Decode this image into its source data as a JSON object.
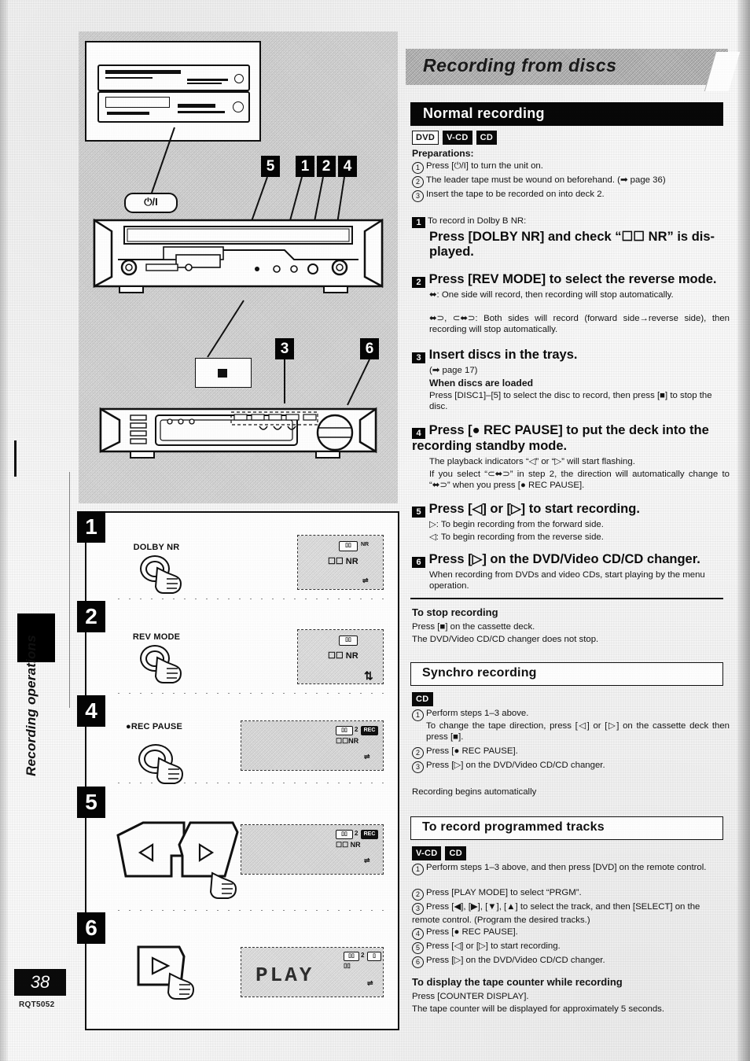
{
  "page": {
    "number": "38",
    "doc_code": "RQT5052",
    "side_tab": "Recording operations"
  },
  "section": {
    "title": "Recording from discs"
  },
  "normal_recording": {
    "heading": "Normal recording",
    "badges": [
      {
        "label": "DVD",
        "style": "outline"
      },
      {
        "label": "V-CD",
        "style": "solid"
      },
      {
        "label": "CD",
        "style": "solid"
      }
    ],
    "preparations_label": "Preparations:",
    "preparations": [
      "Press [⏻/I] to turn the unit on.",
      "The leader tape must be wound on beforehand. (➡ page 36)",
      "Insert the tape to be recorded on into deck 2."
    ],
    "steps": [
      {
        "num": "1",
        "lead": "To record in Dolby B NR:",
        "title": "Press [DOLBY NR] and check “☐☐ NR” is dis-played.",
        "body": []
      },
      {
        "num": "2",
        "lead": "",
        "title": "Press [REV MODE] to select the reverse mode.",
        "body": [
          "⬌:   One side will record, then recording will stop automatically.",
          "⬌⊃, ⊂⬌⊃: Both sides will record (forward side→reverse side), then recording will stop automatically."
        ]
      },
      {
        "num": "3",
        "lead": "",
        "title": "Insert discs in the trays.",
        "body": [
          "(➡ page 17)",
          "When discs are loaded",
          "Press [DISC1]–[5] to select the disc to record, then press [■] to stop the disc."
        ]
      },
      {
        "num": "4",
        "lead": "",
        "title": "Press [● REC PAUSE] to put the deck into the recording standby mode.",
        "body": [
          "The playback indicators “◁” or “▷” will start flashing.",
          "If you select “⊂⬌⊃” in step 2, the direction will automatically change to “⬌⊃” when you press [● REC PAUSE]."
        ]
      },
      {
        "num": "5",
        "lead": "",
        "title": "Press [◁] or [▷] to start recording.",
        "body": [
          "▷: To begin recording from the forward side.",
          "◁: To begin recording from the reverse side."
        ]
      },
      {
        "num": "6",
        "lead": "",
        "title": "Press [▷] on the DVD/Video CD/CD changer.",
        "body": [
          "When recording from DVDs and video CDs, start playing by the menu operation."
        ]
      }
    ],
    "stop": {
      "heading": "To stop recording",
      "lines": [
        "Press [■] on the cassette deck.",
        "The DVD/Video CD/CD changer does not stop."
      ]
    }
  },
  "synchro_recording": {
    "heading": "Synchro recording",
    "badges": [
      {
        "label": "CD",
        "style": "solid"
      }
    ],
    "items": [
      "Perform steps 1–3 above.",
      "To change the tape direction, press [◁] or [▷] on the cassette deck then press [■].",
      "Press [● REC PAUSE].",
      "Press [▷] on the DVD/Video CD/CD changer."
    ],
    "footer": "Recording begins automatically"
  },
  "programmed_tracks": {
    "heading": "To record programmed tracks",
    "badges": [
      {
        "label": "V-CD",
        "style": "solid"
      },
      {
        "label": "CD",
        "style": "solid"
      }
    ],
    "items": [
      "Perform steps 1–3 above, and then press [DVD] on the remote control.",
      "Press [PLAY MODE] to select “PRGM”.",
      "Press [◀], [▶], [▼], [▲] to select the track, and then [SELECT] on the remote control. (Program the desired tracks.)",
      "Press [● REC PAUSE].",
      "Press [◁] or [▷] to start recording.",
      "Press [▷] on the DVD/Video CD/CD changer."
    ]
  },
  "tape_counter": {
    "heading": "To display the tape counter while recording",
    "lines": [
      "Press [COUNTER DISPLAY].",
      "The tape counter will be displayed for approximately 5 seconds."
    ]
  },
  "illustration": {
    "power_button_label": "⏻/I",
    "callouts": [
      "5",
      "1",
      "2",
      "4",
      "3",
      "6"
    ],
    "steps": [
      {
        "num": "1",
        "button_label": "DOLBY NR",
        "display": "☐☐ NR"
      },
      {
        "num": "2",
        "button_label": "REV MODE",
        "display": "☐☐ NR"
      },
      {
        "num": "4",
        "button_label": "●REC PAUSE",
        "display": "☐☐NR"
      },
      {
        "num": "5",
        "button_label_left": "◁",
        "button_label_right": "▷",
        "display": "☐☐ NR"
      },
      {
        "num": "6",
        "button_label": "▷",
        "display": "PLAY"
      }
    ]
  }
}
